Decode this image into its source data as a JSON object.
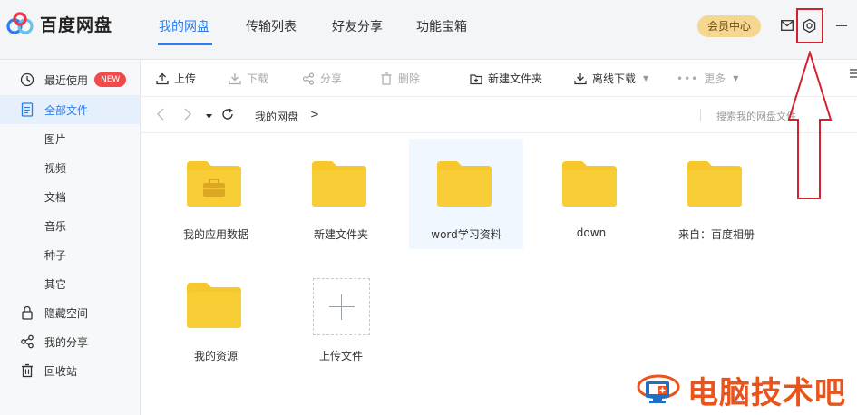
{
  "app": {
    "name": "百度网盘"
  },
  "nav": {
    "tabs": [
      {
        "label": "我的网盘",
        "active": true
      },
      {
        "label": "传输列表",
        "active": false
      },
      {
        "label": "好友分享",
        "active": false
      },
      {
        "label": "功能宝箱",
        "active": false
      }
    ],
    "vip_label": "会员中心",
    "icons": [
      "mail-icon",
      "gear-icon",
      "minimize-icon"
    ]
  },
  "sidebar": {
    "items": [
      {
        "label": "最近使用",
        "icon": "clock-icon",
        "badge": "NEW"
      },
      {
        "label": "全部文件",
        "icon": "file-icon",
        "active": true
      },
      {
        "label": "图片"
      },
      {
        "label": "视频"
      },
      {
        "label": "文档"
      },
      {
        "label": "音乐"
      },
      {
        "label": "种子"
      },
      {
        "label": "其它"
      },
      {
        "label": "隐藏空间",
        "icon": "lock-icon"
      },
      {
        "label": "我的分享",
        "icon": "share-icon"
      },
      {
        "label": "回收站",
        "icon": "trash-icon"
      }
    ]
  },
  "toolbar": {
    "upload": "上传",
    "download": "下载",
    "share": "分享",
    "delete": "删除",
    "new_folder": "新建文件夹",
    "offline_download": "离线下载",
    "more": "更多"
  },
  "pathbar": {
    "crumb": "我的网盘",
    "separator": ">",
    "search_placeholder": "搜索我的网盘文件"
  },
  "files": [
    {
      "name": "我的应用数据",
      "type": "folder-app"
    },
    {
      "name": "新建文件夹",
      "type": "folder"
    },
    {
      "name": "word学习资料",
      "type": "folder",
      "hover": true
    },
    {
      "name": "down",
      "type": "folder"
    },
    {
      "name": "来自：百度相册",
      "type": "folder"
    },
    {
      "name": "我的资源",
      "type": "folder"
    }
  ],
  "upload_tile": {
    "label": "上传文件"
  },
  "colors": {
    "accent": "#2a7ef0",
    "folder": "#f7c72c",
    "highlight": "#d42030",
    "vip": "#f5d792"
  },
  "watermark": {
    "text": "电脑技术吧"
  }
}
